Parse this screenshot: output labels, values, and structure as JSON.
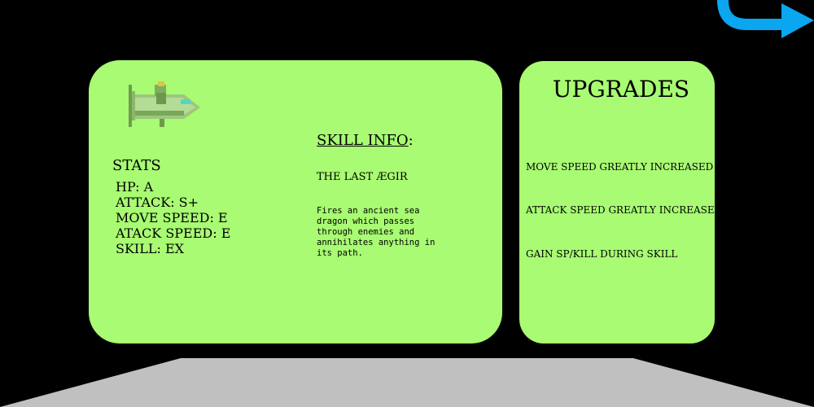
{
  "stats": {
    "heading": "STATS",
    "items": [
      "HP: A",
      "ATTACK: S+",
      "MOVE SPEED: E",
      "ATACK SPEED: E",
      "SKILL: EX"
    ]
  },
  "skill": {
    "heading": "SKILL INFO",
    "heading_suffix": ":",
    "name": "THE LAST ÆGIR",
    "description": "Fires an ancient sea dragon which passes through enemies and annihilates anything in its path."
  },
  "upgrades": {
    "title": "UPGRADES",
    "items": [
      "MOVE SPEED GREATLY INCREASED",
      "ATTACK SPEED GREATLY INCREASED",
      "GAIN SP/KILL DURING SKILL"
    ]
  },
  "icons": {
    "back": "back-arrow-icon",
    "ship": "ship-sprite"
  },
  "colors": {
    "panel": "#a8fb72",
    "background": "#000000",
    "floor": "#c0c0c0",
    "arrow": "#0aa6f0"
  }
}
